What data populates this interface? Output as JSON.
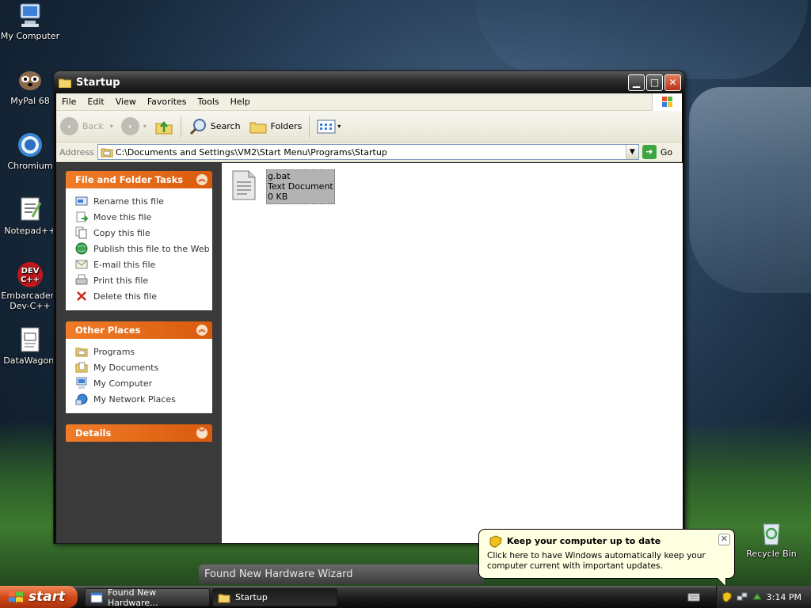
{
  "desktop": {
    "icons": [
      {
        "label": "My Computer"
      },
      {
        "label": "MyPal 68"
      },
      {
        "label": "Chromium"
      },
      {
        "label": "Notepad++"
      },
      {
        "label": "Embarcadero Dev-C++"
      },
      {
        "label": "DataWagon."
      },
      {
        "label": "Recycle Bin"
      }
    ]
  },
  "window": {
    "title": "Startup",
    "menu": [
      "File",
      "Edit",
      "View",
      "Favorites",
      "Tools",
      "Help"
    ],
    "toolbar": {
      "back": "Back",
      "search": "Search",
      "folders": "Folders"
    },
    "address": {
      "label": "Address",
      "value": "C:\\Documents and Settings\\VM2\\Start Menu\\Programs\\Startup",
      "go": "Go"
    },
    "file_tasks": {
      "title": "File and Folder Tasks",
      "items": [
        "Rename this file",
        "Move this file",
        "Copy this file",
        "Publish this file to the Web",
        "E-mail this file",
        "Print this file",
        "Delete this file"
      ]
    },
    "other_places": {
      "title": "Other Places",
      "items": [
        "Programs",
        "My Documents",
        "My Computer",
        "My Network Places"
      ]
    },
    "details": {
      "title": "Details"
    },
    "file": {
      "name": "g.bat",
      "type": "Text Document",
      "size": "0 KB"
    }
  },
  "wizard": {
    "title": "Found New Hardware Wizard"
  },
  "balloon": {
    "title": "Keep your computer up to date",
    "body": "Click here to have Windows automatically keep your computer current with important updates."
  },
  "taskbar": {
    "start": "start",
    "tasks": [
      "Found New Hardware...",
      "Startup"
    ],
    "clock": "3:14 PM"
  }
}
